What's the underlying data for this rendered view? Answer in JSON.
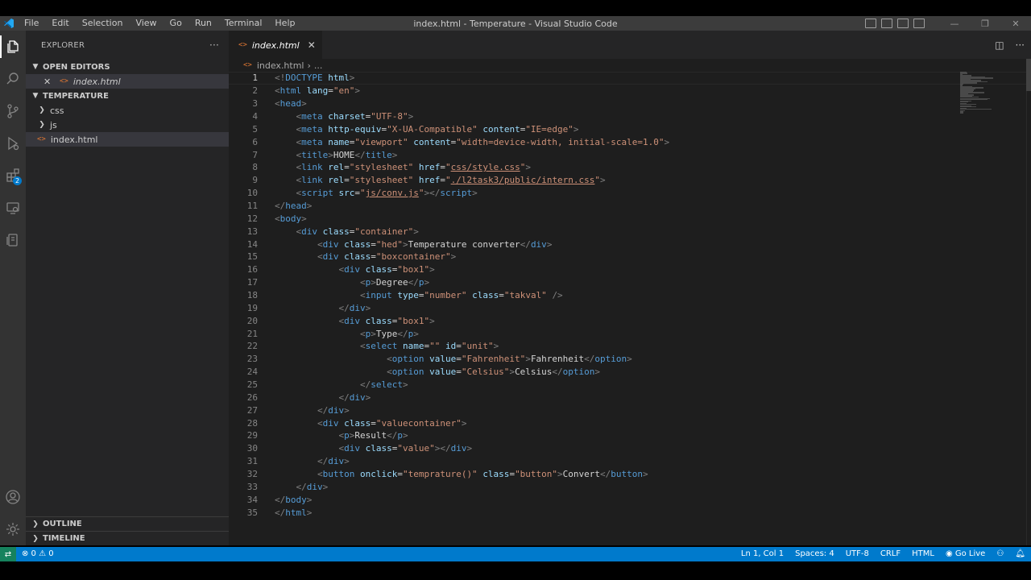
{
  "window": {
    "title": "index.html - Temperature - Visual Studio Code",
    "menu": [
      "File",
      "Edit",
      "Selection",
      "View",
      "Go",
      "Run",
      "Terminal",
      "Help"
    ],
    "controls": {
      "minimize": "—",
      "restore": "❐",
      "close": "✕"
    }
  },
  "activitybar": {
    "items": [
      "explorer-icon",
      "search-icon",
      "source-control-icon",
      "run-debug-icon",
      "extensions-icon",
      "remote-explorer-icon",
      "live-share-icon"
    ],
    "extensions_badge": "2",
    "bottom": [
      "account-icon",
      "gear-icon"
    ]
  },
  "sidebar": {
    "title": "EXPLORER",
    "more": "···",
    "open_editors": {
      "title": "OPEN EDITORS",
      "files": [
        {
          "name": "index.html"
        }
      ]
    },
    "folder": {
      "title": "TEMPERATURE",
      "items": [
        {
          "name": "css",
          "type": "folder"
        },
        {
          "name": "js",
          "type": "folder"
        },
        {
          "name": "index.html",
          "type": "file"
        }
      ]
    },
    "outline": "OUTLINE",
    "timeline": "TIMELINE"
  },
  "editor": {
    "tab": {
      "label": "index.html",
      "close": "✕"
    },
    "breadcrumb": {
      "file": "index.html",
      "sep": "›",
      "rest": "..."
    },
    "current_line": 1,
    "lines": [
      [
        [
          "p",
          "<!"
        ],
        [
          "t",
          "DOCTYPE"
        ],
        [
          "x",
          " "
        ],
        [
          "a",
          "html"
        ],
        [
          "p",
          ">"
        ]
      ],
      [
        [
          "p",
          "<"
        ],
        [
          "t",
          "html"
        ],
        [
          "x",
          " "
        ],
        [
          "a",
          "lang"
        ],
        [
          "x",
          "="
        ],
        [
          "v",
          "\"en\""
        ],
        [
          "p",
          ">"
        ]
      ],
      [
        [
          "p",
          "<"
        ],
        [
          "t",
          "head"
        ],
        [
          "p",
          ">"
        ]
      ],
      [
        [
          "x",
          "    "
        ],
        [
          "p",
          "<"
        ],
        [
          "t",
          "meta"
        ],
        [
          "x",
          " "
        ],
        [
          "a",
          "charset"
        ],
        [
          "x",
          "="
        ],
        [
          "v",
          "\"UTF-8\""
        ],
        [
          "p",
          ">"
        ]
      ],
      [
        [
          "x",
          "    "
        ],
        [
          "p",
          "<"
        ],
        [
          "t",
          "meta"
        ],
        [
          "x",
          " "
        ],
        [
          "a",
          "http-equiv"
        ],
        [
          "x",
          "="
        ],
        [
          "v",
          "\"X-UA-Compatible\""
        ],
        [
          "x",
          " "
        ],
        [
          "a",
          "content"
        ],
        [
          "x",
          "="
        ],
        [
          "v",
          "\"IE=edge\""
        ],
        [
          "p",
          ">"
        ]
      ],
      [
        [
          "x",
          "    "
        ],
        [
          "p",
          "<"
        ],
        [
          "t",
          "meta"
        ],
        [
          "x",
          " "
        ],
        [
          "a",
          "name"
        ],
        [
          "x",
          "="
        ],
        [
          "v",
          "\"viewport\""
        ],
        [
          "x",
          " "
        ],
        [
          "a",
          "content"
        ],
        [
          "x",
          "="
        ],
        [
          "v",
          "\"width=device-width, initial-scale=1.0\""
        ],
        [
          "p",
          ">"
        ]
      ],
      [
        [
          "x",
          "    "
        ],
        [
          "p",
          "<"
        ],
        [
          "t",
          "title"
        ],
        [
          "p",
          ">"
        ],
        [
          "x",
          "HOME"
        ],
        [
          "p",
          "</"
        ],
        [
          "t",
          "title"
        ],
        [
          "p",
          ">"
        ]
      ],
      [
        [
          "x",
          "    "
        ],
        [
          "p",
          "<"
        ],
        [
          "t",
          "link"
        ],
        [
          "x",
          " "
        ],
        [
          "a",
          "rel"
        ],
        [
          "x",
          "="
        ],
        [
          "v",
          "\"stylesheet\""
        ],
        [
          "x",
          " "
        ],
        [
          "a",
          "href"
        ],
        [
          "x",
          "="
        ],
        [
          "v",
          "\""
        ],
        [
          "vu",
          "css/style.css"
        ],
        [
          "v",
          "\""
        ],
        [
          "p",
          ">"
        ]
      ],
      [
        [
          "x",
          "    "
        ],
        [
          "p",
          "<"
        ],
        [
          "t",
          "link"
        ],
        [
          "x",
          " "
        ],
        [
          "a",
          "rel"
        ],
        [
          "x",
          "="
        ],
        [
          "v",
          "\"stylesheet\""
        ],
        [
          "x",
          " "
        ],
        [
          "a",
          "href"
        ],
        [
          "x",
          "="
        ],
        [
          "v",
          "\""
        ],
        [
          "vu",
          "./l2task3/public/intern.css"
        ],
        [
          "v",
          "\""
        ],
        [
          "p",
          ">"
        ]
      ],
      [
        [
          "x",
          "    "
        ],
        [
          "p",
          "<"
        ],
        [
          "t",
          "script"
        ],
        [
          "x",
          " "
        ],
        [
          "a",
          "src"
        ],
        [
          "x",
          "="
        ],
        [
          "v",
          "\""
        ],
        [
          "vu",
          "js/conv.js"
        ],
        [
          "v",
          "\""
        ],
        [
          "p",
          "></"
        ],
        [
          "t",
          "script"
        ],
        [
          "p",
          ">"
        ]
      ],
      [
        [
          "p",
          "</"
        ],
        [
          "t",
          "head"
        ],
        [
          "p",
          ">"
        ]
      ],
      [
        [
          "p",
          "<"
        ],
        [
          "t",
          "body"
        ],
        [
          "p",
          ">"
        ]
      ],
      [
        [
          "x",
          "    "
        ],
        [
          "p",
          "<"
        ],
        [
          "t",
          "div"
        ],
        [
          "x",
          " "
        ],
        [
          "a",
          "class"
        ],
        [
          "x",
          "="
        ],
        [
          "v",
          "\"container\""
        ],
        [
          "p",
          ">"
        ]
      ],
      [
        [
          "x",
          "        "
        ],
        [
          "p",
          "<"
        ],
        [
          "t",
          "div"
        ],
        [
          "x",
          " "
        ],
        [
          "a",
          "class"
        ],
        [
          "x",
          "="
        ],
        [
          "v",
          "\"hed\""
        ],
        [
          "p",
          ">"
        ],
        [
          "x",
          "Temperature converter"
        ],
        [
          "p",
          "</"
        ],
        [
          "t",
          "div"
        ],
        [
          "p",
          ">"
        ]
      ],
      [
        [
          "x",
          "        "
        ],
        [
          "p",
          "<"
        ],
        [
          "t",
          "div"
        ],
        [
          "x",
          " "
        ],
        [
          "a",
          "class"
        ],
        [
          "x",
          "="
        ],
        [
          "v",
          "\"boxcontainer\""
        ],
        [
          "p",
          ">"
        ]
      ],
      [
        [
          "x",
          "            "
        ],
        [
          "p",
          "<"
        ],
        [
          "t",
          "div"
        ],
        [
          "x",
          " "
        ],
        [
          "a",
          "class"
        ],
        [
          "x",
          "="
        ],
        [
          "v",
          "\"box1\""
        ],
        [
          "p",
          ">"
        ]
      ],
      [
        [
          "x",
          "                "
        ],
        [
          "p",
          "<"
        ],
        [
          "t",
          "p"
        ],
        [
          "p",
          ">"
        ],
        [
          "x",
          "Degree"
        ],
        [
          "p",
          "</"
        ],
        [
          "t",
          "p"
        ],
        [
          "p",
          ">"
        ]
      ],
      [
        [
          "x",
          "                "
        ],
        [
          "p",
          "<"
        ],
        [
          "t",
          "input"
        ],
        [
          "x",
          " "
        ],
        [
          "a",
          "type"
        ],
        [
          "x",
          "="
        ],
        [
          "v",
          "\"number\""
        ],
        [
          "x",
          " "
        ],
        [
          "a",
          "class"
        ],
        [
          "x",
          "="
        ],
        [
          "v",
          "\"takval\""
        ],
        [
          "x",
          " "
        ],
        [
          "p",
          "/>"
        ]
      ],
      [
        [
          "x",
          "            "
        ],
        [
          "p",
          "</"
        ],
        [
          "t",
          "div"
        ],
        [
          "p",
          ">"
        ]
      ],
      [
        [
          "x",
          "            "
        ],
        [
          "p",
          "<"
        ],
        [
          "t",
          "div"
        ],
        [
          "x",
          " "
        ],
        [
          "a",
          "class"
        ],
        [
          "x",
          "="
        ],
        [
          "v",
          "\"box1\""
        ],
        [
          "p",
          ">"
        ]
      ],
      [
        [
          "x",
          "                "
        ],
        [
          "p",
          "<"
        ],
        [
          "t",
          "p"
        ],
        [
          "p",
          ">"
        ],
        [
          "x",
          "Type"
        ],
        [
          "p",
          "</"
        ],
        [
          "t",
          "p"
        ],
        [
          "p",
          ">"
        ]
      ],
      [
        [
          "x",
          "                "
        ],
        [
          "p",
          "<"
        ],
        [
          "t",
          "select"
        ],
        [
          "x",
          " "
        ],
        [
          "a",
          "name"
        ],
        [
          "x",
          "="
        ],
        [
          "v",
          "\"\""
        ],
        [
          "x",
          " "
        ],
        [
          "a",
          "id"
        ],
        [
          "x",
          "="
        ],
        [
          "v",
          "\"unit\""
        ],
        [
          "p",
          ">"
        ]
      ],
      [
        [
          "x",
          "                     "
        ],
        [
          "p",
          "<"
        ],
        [
          "t",
          "option"
        ],
        [
          "x",
          " "
        ],
        [
          "a",
          "value"
        ],
        [
          "x",
          "="
        ],
        [
          "v",
          "\"Fahrenheit\""
        ],
        [
          "p",
          ">"
        ],
        [
          "x",
          "Fahrenheit"
        ],
        [
          "p",
          "</"
        ],
        [
          "t",
          "option"
        ],
        [
          "p",
          ">"
        ]
      ],
      [
        [
          "x",
          "                     "
        ],
        [
          "p",
          "<"
        ],
        [
          "t",
          "option"
        ],
        [
          "x",
          " "
        ],
        [
          "a",
          "value"
        ],
        [
          "x",
          "="
        ],
        [
          "v",
          "\"Celsius\""
        ],
        [
          "p",
          ">"
        ],
        [
          "x",
          "Celsius"
        ],
        [
          "p",
          "</"
        ],
        [
          "t",
          "option"
        ],
        [
          "p",
          ">"
        ]
      ],
      [
        [
          "x",
          "                "
        ],
        [
          "p",
          "</"
        ],
        [
          "t",
          "select"
        ],
        [
          "p",
          ">"
        ]
      ],
      [
        [
          "x",
          "            "
        ],
        [
          "p",
          "</"
        ],
        [
          "t",
          "div"
        ],
        [
          "p",
          ">"
        ]
      ],
      [
        [
          "x",
          "        "
        ],
        [
          "p",
          "</"
        ],
        [
          "t",
          "div"
        ],
        [
          "p",
          ">"
        ]
      ],
      [
        [
          "x",
          "        "
        ],
        [
          "p",
          "<"
        ],
        [
          "t",
          "div"
        ],
        [
          "x",
          " "
        ],
        [
          "a",
          "class"
        ],
        [
          "x",
          "="
        ],
        [
          "v",
          "\"valuecontainer\""
        ],
        [
          "p",
          ">"
        ]
      ],
      [
        [
          "x",
          "            "
        ],
        [
          "p",
          "<"
        ],
        [
          "t",
          "p"
        ],
        [
          "p",
          ">"
        ],
        [
          "x",
          "Result"
        ],
        [
          "p",
          "</"
        ],
        [
          "t",
          "p"
        ],
        [
          "p",
          ">"
        ]
      ],
      [
        [
          "x",
          "            "
        ],
        [
          "p",
          "<"
        ],
        [
          "t",
          "div"
        ],
        [
          "x",
          " "
        ],
        [
          "a",
          "class"
        ],
        [
          "x",
          "="
        ],
        [
          "v",
          "\"value\""
        ],
        [
          "p",
          "></"
        ],
        [
          "t",
          "div"
        ],
        [
          "p",
          ">"
        ]
      ],
      [
        [
          "x",
          "        "
        ],
        [
          "p",
          "</"
        ],
        [
          "t",
          "div"
        ],
        [
          "p",
          ">"
        ]
      ],
      [
        [
          "x",
          "        "
        ],
        [
          "p",
          "<"
        ],
        [
          "t",
          "button"
        ],
        [
          "x",
          " "
        ],
        [
          "a",
          "onclick"
        ],
        [
          "x",
          "="
        ],
        [
          "v",
          "\"temprature()\""
        ],
        [
          "x",
          " "
        ],
        [
          "a",
          "class"
        ],
        [
          "x",
          "="
        ],
        [
          "v",
          "\"button\""
        ],
        [
          "p",
          ">"
        ],
        [
          "x",
          "Convert"
        ],
        [
          "p",
          "</"
        ],
        [
          "t",
          "button"
        ],
        [
          "p",
          ">"
        ]
      ],
      [
        [
          "x",
          "    "
        ],
        [
          "p",
          "</"
        ],
        [
          "t",
          "div"
        ],
        [
          "p",
          ">"
        ]
      ],
      [
        [
          "p",
          "</"
        ],
        [
          "t",
          "body"
        ],
        [
          "p",
          ">"
        ]
      ],
      [
        [
          "p",
          "</"
        ],
        [
          "t",
          "html"
        ],
        [
          "p",
          ">"
        ]
      ]
    ]
  },
  "statusbar": {
    "remote": "⇄",
    "errors": "⊗ 0",
    "warnings": "⚠ 0",
    "position": "Ln 1, Col 1",
    "spaces": "Spaces: 4",
    "encoding": "UTF-8",
    "eol": "CRLF",
    "language": "HTML",
    "golive": "Go Live"
  },
  "colors": {
    "accent": "#007acc",
    "tag": "#569cd6",
    "attribute": "#9cdcfe",
    "string": "#ce9178",
    "punctuation": "#808080",
    "html_file_icon": "#e37933"
  }
}
